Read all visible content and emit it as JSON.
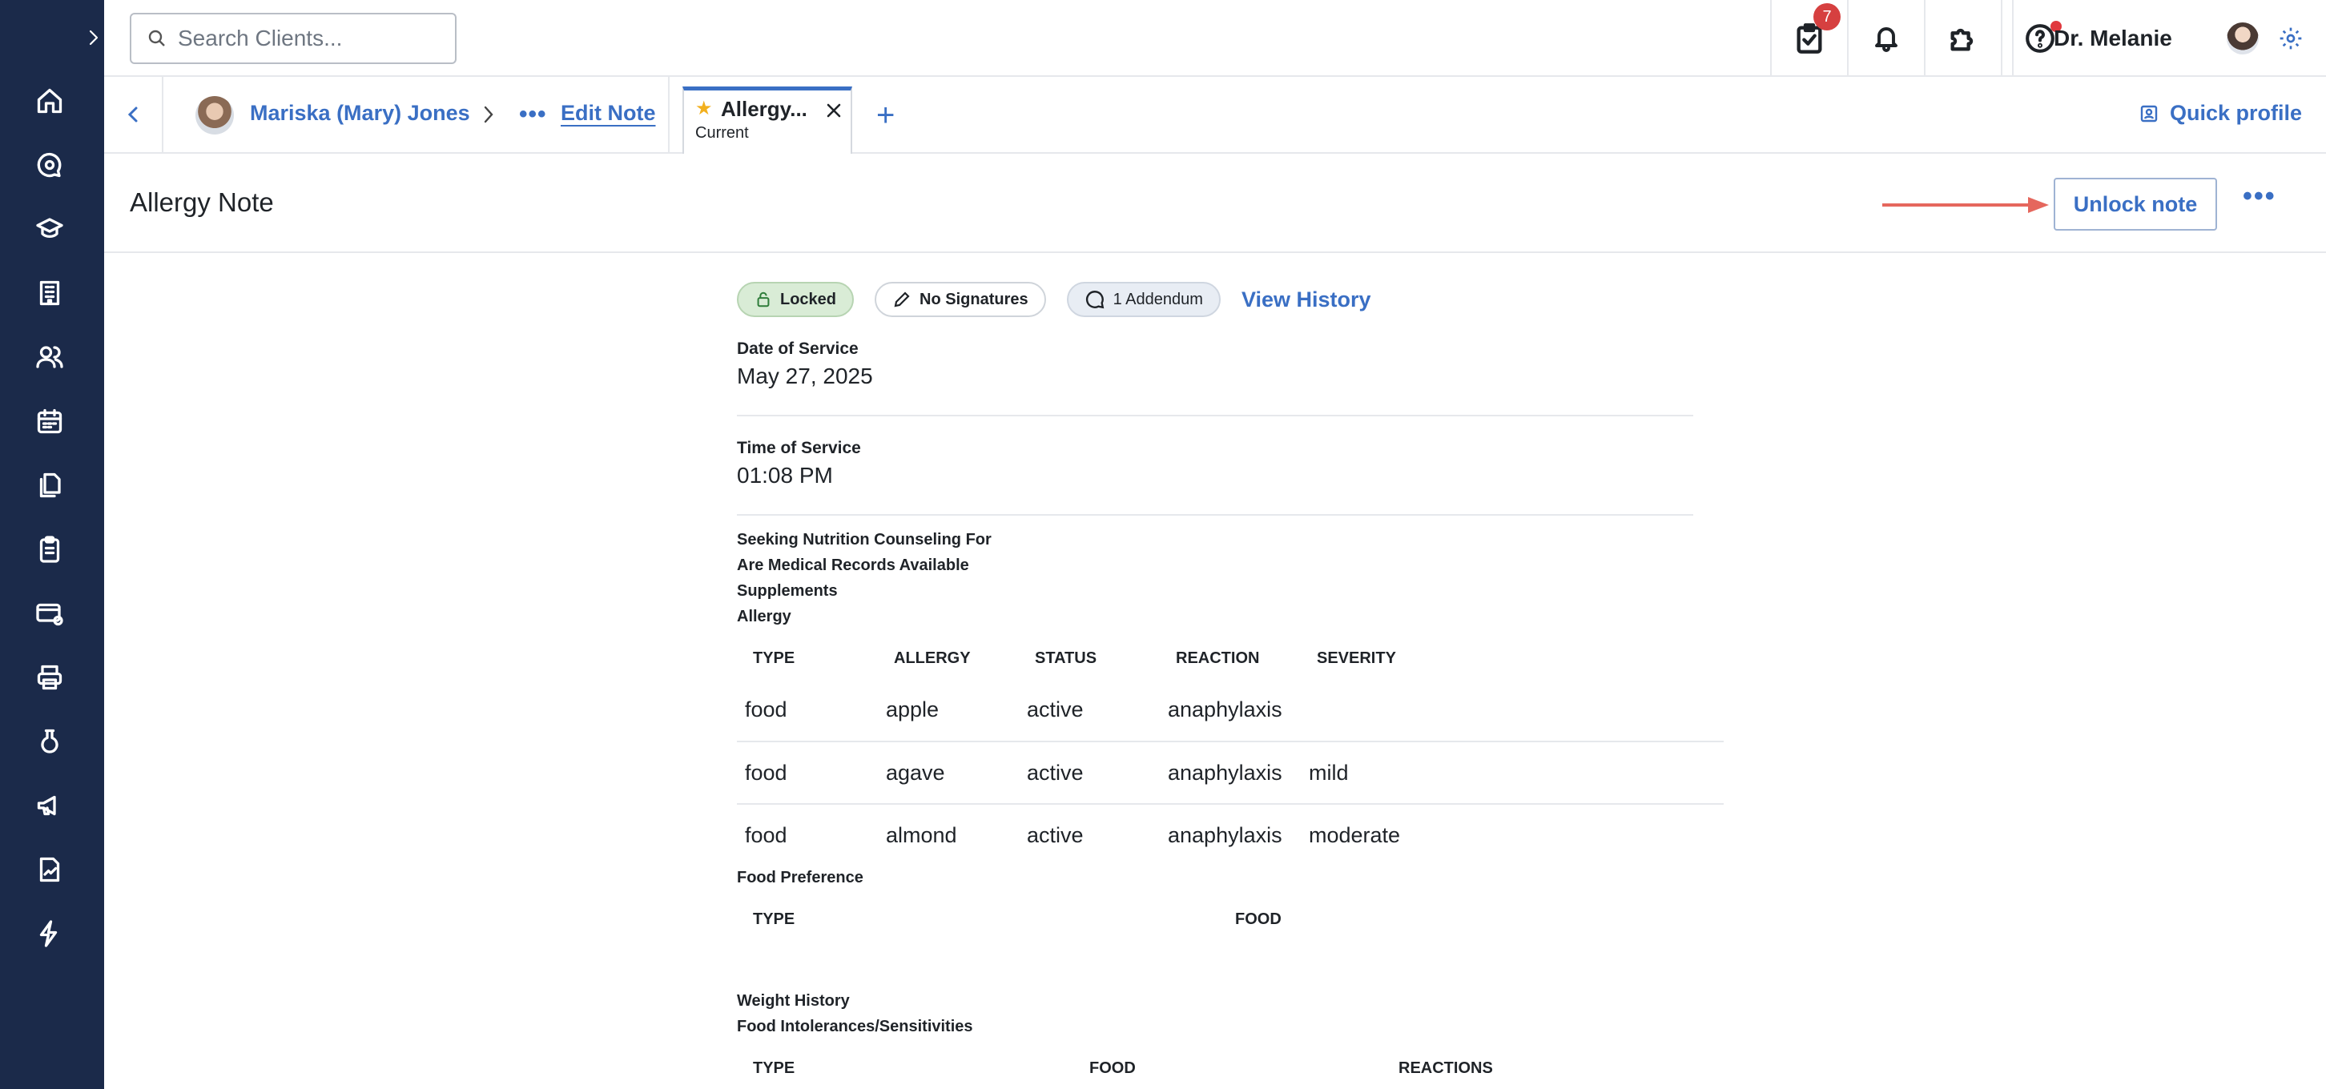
{
  "topbar": {
    "search_placeholder": "Search Clients...",
    "tasks_badge": "7",
    "user_name": "Dr. Melanie"
  },
  "tabs": {
    "client_name": "Mariska (Mary) Jones",
    "edit_note": "Edit Note",
    "active_tab_title": "Allergy...",
    "active_tab_sub": "Current",
    "quick_profile": "Quick profile"
  },
  "page": {
    "title": "Allergy Note",
    "unlock_label": "Unlock note"
  },
  "chips": {
    "locked": "Locked",
    "no_signatures": "No Signatures",
    "addendum": "1 Addendum",
    "view_history": "View History"
  },
  "fields": {
    "date_label": "Date of Service",
    "date_value": "May 27, 2025",
    "time_label": "Time of Service",
    "time_value": "01:08 PM",
    "q1": "Seeking Nutrition Counseling For",
    "q2": "Are Medical Records Available",
    "q3": "Supplements",
    "q4": "Allergy"
  },
  "allergy_table": {
    "headers": [
      "TYPE",
      "ALLERGY",
      "STATUS",
      "REACTION",
      "SEVERITY"
    ],
    "rows": [
      [
        "food",
        "apple",
        "active",
        "anaphylaxis",
        ""
      ],
      [
        "food",
        "agave",
        "active",
        "anaphylaxis",
        "mild"
      ],
      [
        "food",
        "almond",
        "active",
        "anaphylaxis",
        "moderate"
      ]
    ]
  },
  "food_pref": {
    "label": "Food Preference",
    "h_type": "TYPE",
    "h_food": "FOOD"
  },
  "weight": {
    "label": "Weight History"
  },
  "intolerances": {
    "label": "Food Intolerances/Sensitivities",
    "h_type": "TYPE",
    "h_food": "FOOD",
    "h_reactions": "REACTIONS"
  }
}
